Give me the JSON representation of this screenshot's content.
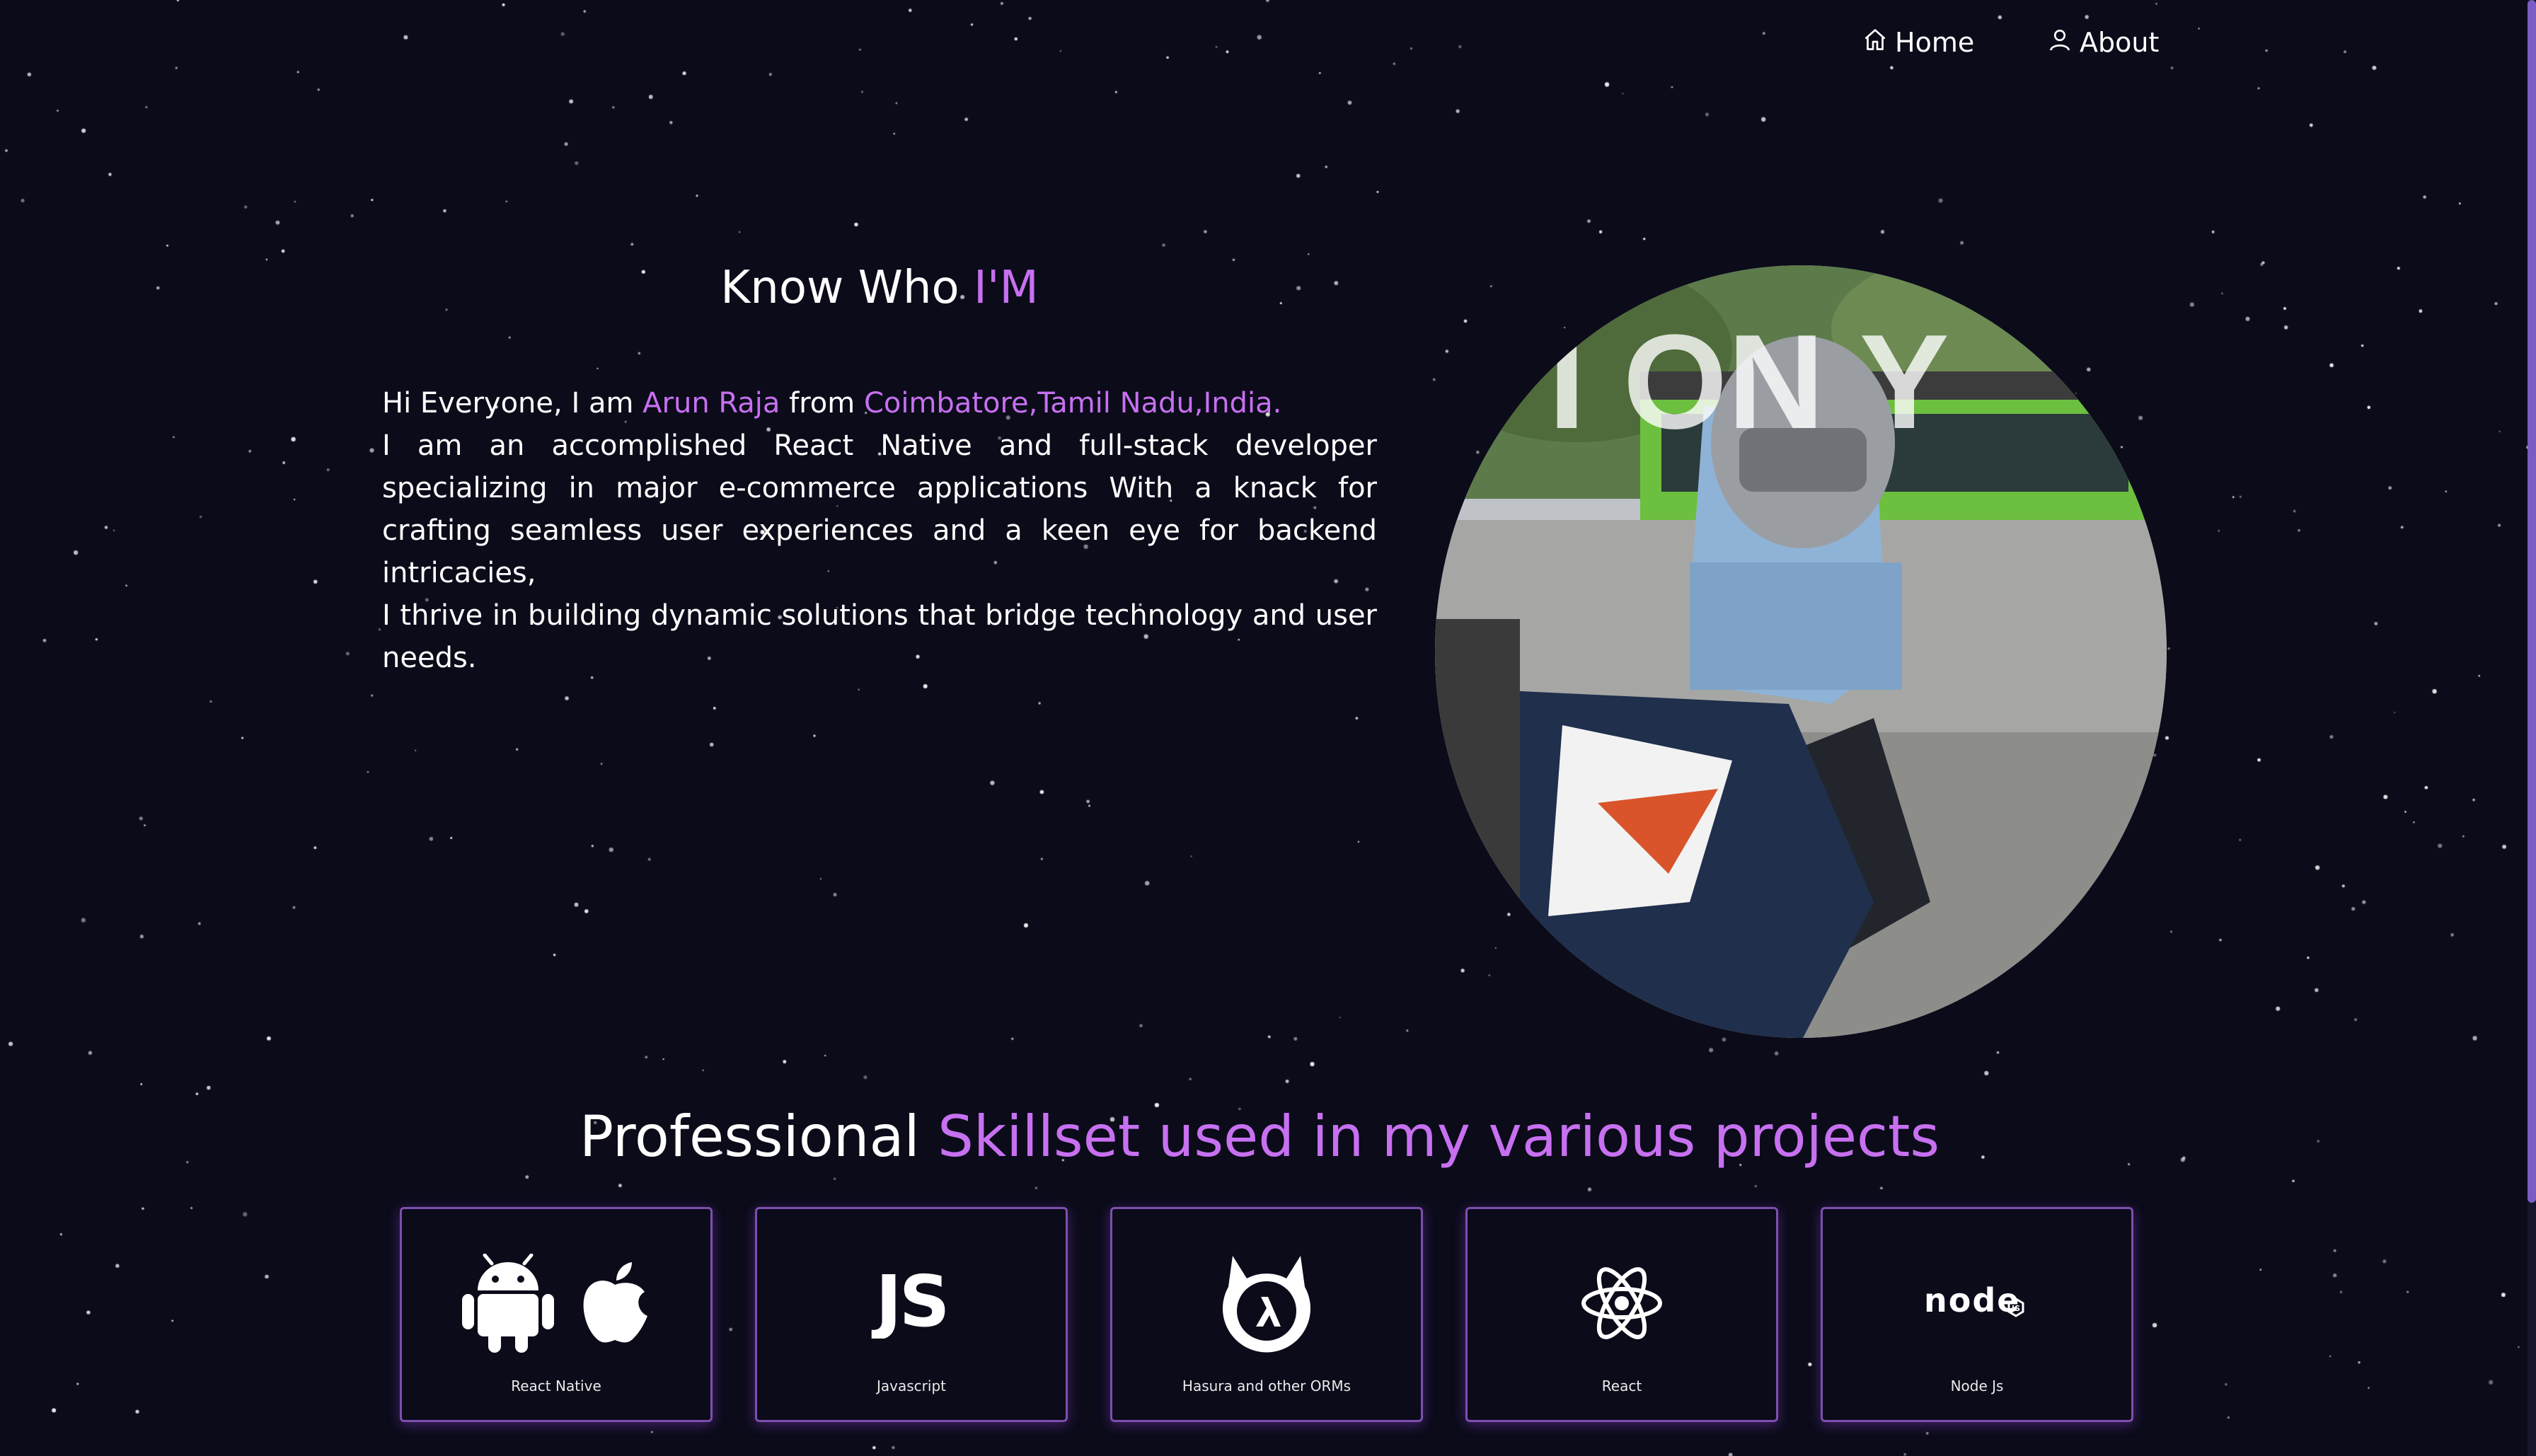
{
  "nav": {
    "home_label": "Home",
    "home_icon": "home-icon",
    "about_label": "About",
    "about_icon": "user-icon"
  },
  "about": {
    "heading_plain": "Know Who ",
    "heading_accent": "I'M",
    "greeting_prefix": "Hi Everyone, I am ",
    "name": "Arun Raja",
    "from_word": " from ",
    "location": "Coimbatore,Tamil Nadu,India.",
    "paragraph_1": "I am an accomplished React Native and full-stack developer specializing in major e-commerce applications With a knack for crafting seamless user experiences and a keen eye for backend intricacies,",
    "paragraph_2": "I thrive in building dynamic solutions that bridge technology and user needs.",
    "photo_overlay_text": "I ON Y"
  },
  "skills": {
    "heading_plain": "Professional ",
    "heading_accent": "Skillset used in my various projects",
    "items": [
      {
        "label": "React Native",
        "icon": "android-apple-icon"
      },
      {
        "label": "Javascript",
        "icon": "javascript-icon"
      },
      {
        "label": "Hasura and other ORMs",
        "icon": "hasura-icon"
      },
      {
        "label": "React",
        "icon": "react-icon"
      },
      {
        "label": "Node Js",
        "icon": "nodejs-icon"
      }
    ]
  },
  "colors": {
    "background": "#0b0b1a",
    "accent": "#c770f0",
    "card_border": "#7d4fb0"
  }
}
